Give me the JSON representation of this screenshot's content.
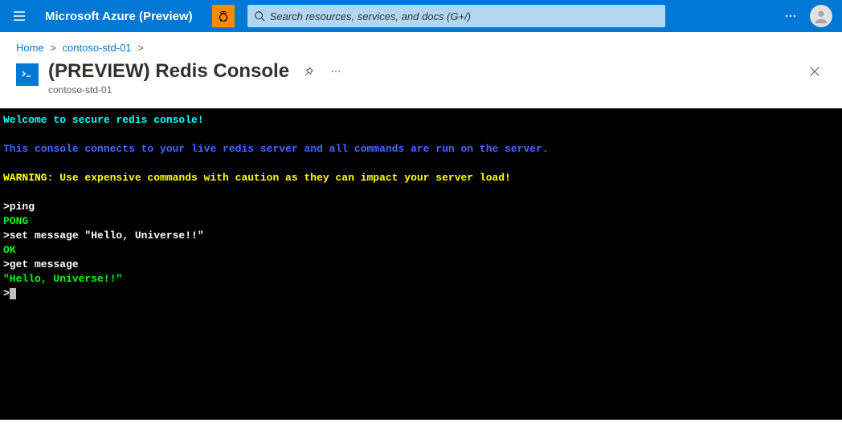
{
  "topbar": {
    "brand": "Microsoft Azure (Preview)",
    "search_placeholder": "Search resources, services, and docs (G+/)"
  },
  "breadcrumb": {
    "items": [
      "Home",
      "contoso-std-01"
    ]
  },
  "header": {
    "title": "(PREVIEW) Redis Console",
    "subtitle": "contoso-std-01"
  },
  "console": {
    "welcome": "Welcome to secure redis console!",
    "info": "This console connects to your live redis server and all commands are run on the server.",
    "warning": "WARNING: Use expensive commands with caution as they can impact your server load!",
    "lines": [
      {
        "type": "cmd",
        "text": ">ping"
      },
      {
        "type": "resp",
        "text": "PONG"
      },
      {
        "type": "cmd",
        "text": ">set message \"Hello, Universe!!\""
      },
      {
        "type": "resp",
        "text": "OK"
      },
      {
        "type": "cmd",
        "text": ">get message"
      },
      {
        "type": "resp",
        "text": "\"Hello, Universe!!\""
      }
    ],
    "prompt": ">"
  }
}
